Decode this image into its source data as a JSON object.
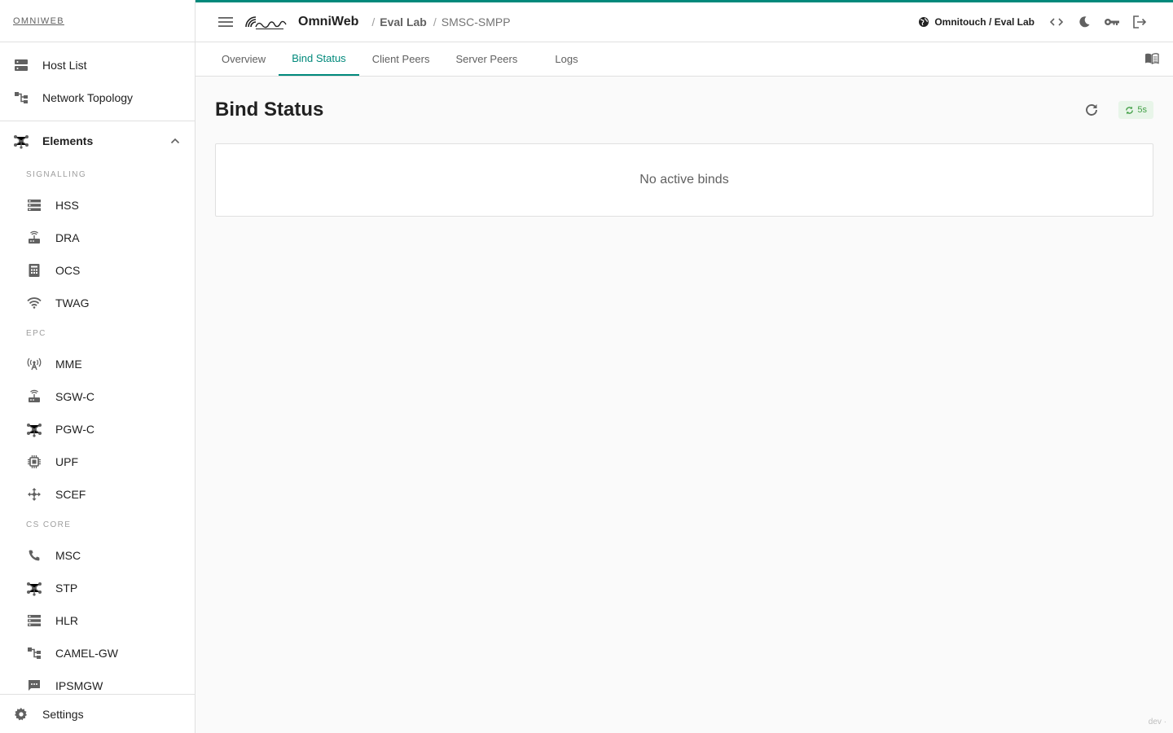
{
  "brand": "OMNIWEB",
  "nav_top": [
    {
      "label": "Host List",
      "icon": "server-icon"
    },
    {
      "label": "Network Topology",
      "icon": "topology-icon"
    }
  ],
  "elements_group": {
    "label": "Elements"
  },
  "sections": {
    "signalling": "SIGNALLING",
    "epc": "EPC",
    "cs_core": "CS CORE"
  },
  "signalling_items": [
    "HSS",
    "DRA",
    "OCS",
    "TWAG"
  ],
  "epc_items": [
    "MME",
    "SGW-C",
    "PGW-C",
    "UPF",
    "SCEF"
  ],
  "cs_items": [
    "MSC",
    "STP",
    "HLR",
    "CAMEL-GW",
    "IPSMGW"
  ],
  "settings_label": "Settings",
  "topbar": {
    "app_name": "OmniWeb",
    "breadcrumb": [
      "Eval Lab",
      "SMSC-SMPP"
    ],
    "org": "Omnitouch / Eval Lab"
  },
  "tabs": [
    "Overview",
    "Bind Status",
    "Client Peers",
    "Server Peers",
    "Logs"
  ],
  "active_tab": "Bind Status",
  "page": {
    "title": "Bind Status",
    "auto_refresh": "5s",
    "empty_message": "No active binds"
  },
  "version": "dev ·",
  "colors": {
    "accent": "#00897b",
    "chip_bg": "#e8f5e9",
    "chip_fg": "#43a047"
  }
}
